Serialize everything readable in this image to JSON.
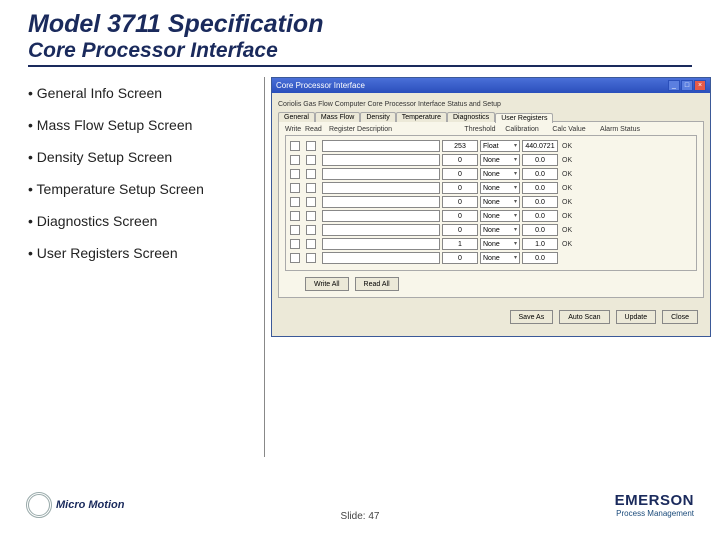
{
  "header": {
    "title": "Model 3711 Specification",
    "subtitle": "Core Processor Interface"
  },
  "bullets": [
    "• General Info Screen",
    "• Mass Flow Setup Screen",
    "• Density Setup Screen",
    "• Temperature Setup Screen",
    "• Diagnostics Screen",
    "• User Registers Screen"
  ],
  "window": {
    "title": "Core Processor Interface",
    "caption": "Coriolis Gas Flow Computer Core Processor Interface Status and Setup",
    "tabs": [
      "General",
      "Mass Flow",
      "Density",
      "Temperature",
      "Diagnostics",
      "User Registers"
    ],
    "group": {
      "hdr_tag1": "Write",
      "hdr_tag2": "Read",
      "hdr_desc": "Register Description",
      "hdr_th": "Threshold",
      "hdr_cal": "Calibration",
      "hdr_val": "Calc Value",
      "hdr_alarm": "Alarm Status",
      "rows": [
        {
          "desc": "",
          "th": "253",
          "cal": "Float",
          "val": "440.0721",
          "alarm": "OK"
        },
        {
          "desc": "",
          "th": "0",
          "cal": "None",
          "val": "0.0",
          "alarm": "OK"
        },
        {
          "desc": "",
          "th": "0",
          "cal": "None",
          "val": "0.0",
          "alarm": "OK"
        },
        {
          "desc": "",
          "th": "0",
          "cal": "None",
          "val": "0.0",
          "alarm": "OK"
        },
        {
          "desc": "",
          "th": "0",
          "cal": "None",
          "val": "0.0",
          "alarm": "OK"
        },
        {
          "desc": "",
          "th": "0",
          "cal": "None",
          "val": "0.0",
          "alarm": "OK"
        },
        {
          "desc": "",
          "th": "0",
          "cal": "None",
          "val": "0.0",
          "alarm": "OK"
        },
        {
          "desc": "",
          "th": "1",
          "cal": "None",
          "val": "1.0",
          "alarm": "OK"
        },
        {
          "desc": "",
          "th": "0",
          "cal": "None",
          "val": "0.0",
          "alarm": ""
        }
      ]
    },
    "buttons": {
      "writeAll": "Write All",
      "readAll": "Read All",
      "saveAs": "Save As",
      "autoScan": "Auto Scan",
      "update": "Update",
      "close": "Close"
    }
  },
  "footer": {
    "micromotion": "Micro Motion",
    "slide": "Slide: 47",
    "emerson": "EMERSON",
    "emersonSub": "Process Management"
  }
}
